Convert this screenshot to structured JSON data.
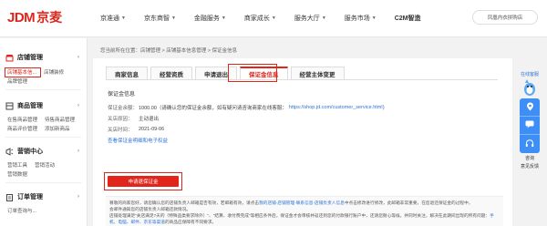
{
  "logo": {
    "letters": "JDM",
    "name": "京麦"
  },
  "nav": [
    {
      "label": "京准通",
      "caret": true
    },
    {
      "label": "京东商智",
      "caret": true
    },
    {
      "label": "金融服务",
      "caret": true
    },
    {
      "label": "商家成长",
      "caret": true
    },
    {
      "label": "服务大厅",
      "caret": true
    },
    {
      "label": "服务市场",
      "caret": true
    },
    {
      "label": "C2M智造",
      "caret": false
    }
  ],
  "store": "凤凰内衣拼购店",
  "sidebar": {
    "shop": {
      "title": "店铺管理",
      "rows": [
        [
          "店铺基本信...",
          "店铺装修"
        ],
        [
          "品牌管理"
        ]
      ]
    },
    "product": {
      "title": "商品管理",
      "rows": [
        [
          "在售商品管理",
          "待售商品管理"
        ],
        [
          "商品评价管理",
          "添加新商品"
        ]
      ]
    },
    "marketing": {
      "title": "营销中心",
      "rows": [
        [
          "营销工具",
          "营销活动"
        ],
        [
          "营销数据"
        ]
      ]
    },
    "order": {
      "title": "订单管理",
      "rows": [
        [
          "订单查询与..."
        ]
      ]
    }
  },
  "breadcrumb": "您当前所在位置：店铺管理 > 店铺基本信息管理 > 保证金信息",
  "tabs": [
    "商家信息",
    "经营资质",
    "申请退出",
    "保证金信息",
    "经营主体变更"
  ],
  "deposit": {
    "section_title": "保证金信息",
    "amount_label": "保证金余额：",
    "amount_value": "1000.00（请确认您的保证金余额，如有疑问请咨询商家在线客服：",
    "service_url": "https://shop.jd.com/customer_service.html",
    "amount_suffix": "）",
    "close_reason_label": "关店原因：",
    "close_reason_value": "主动退出",
    "close_time_label": "关店时间：",
    "close_time_value": "2021-09-06",
    "detail_link": "查看保证金明细和电子权益",
    "apply_button": "申请退保证金"
  },
  "notice": {
    "line1a": "尊敬的商家您好，请您确认您的店铺负责人邮箱是否有效，若邮箱有效，请点击",
    "line1b": "我的店铺-店铺管理-联系信息-店铺负责人信息",
    "line1c": "中点击修改进行修改，此邮箱非常重要，在您退还保证金的过程中，",
    "line2": "会邮件通知您的店铺负责人邮箱还款情况。",
    "line3a": "店铺处理满足\"关店满足7天的（特殊品类要求除外）\"、\"结算、收付费完成\"等相应条件后，保证金才会审核并返还到您的付款银行账户中，还请您耐心等候。并同时关注，解决在此期间出现的",
    "line3b": "所有问题：",
    "line3c": "手机、电脑、邮件、京东等渠道",
    "line3d": "的商品应保障有不同要求。"
  },
  "floatwidget": {
    "label": "在线客服",
    "consult": "咨询",
    "feedback": "意见反馈"
  }
}
